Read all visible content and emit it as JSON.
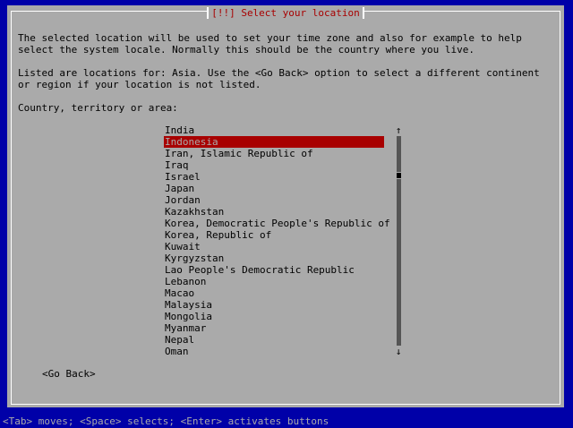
{
  "dialog": {
    "title": "[!!] Select your location",
    "paragraph1_line1": "The selected location will be used to set your time zone and also for example to help",
    "paragraph1_line2": "select the system locale. Normally this should be the country where you live.",
    "paragraph2_line1": "Listed are locations for: Asia. Use the <Go Back> option to select a different continent",
    "paragraph2_line2": "or region if your location is not listed.",
    "list_label": "Country, territory or area:",
    "selected_index": 1,
    "items": [
      "India",
      "Indonesia",
      "Iran, Islamic Republic of",
      "Iraq",
      "Israel",
      "Japan",
      "Jordan",
      "Kazakhstan",
      "Korea, Democratic People's Republic of",
      "Korea, Republic of",
      "Kuwait",
      "Kyrgyzstan",
      "Lao People's Democratic Republic",
      "Lebanon",
      "Macao",
      "Malaysia",
      "Mongolia",
      "Myanmar",
      "Nepal",
      "Oman"
    ],
    "scroll_up": "↑",
    "scroll_down": "↓",
    "go_back_label": "<Go Back>"
  },
  "status_bar": {
    "text": "<Tab> moves; <Space> selects; <Enter> activates buttons"
  },
  "colors": {
    "background": "#0000a8",
    "dialog": "#aaaaaa",
    "title": "#a80000",
    "selection": "#a80000"
  }
}
